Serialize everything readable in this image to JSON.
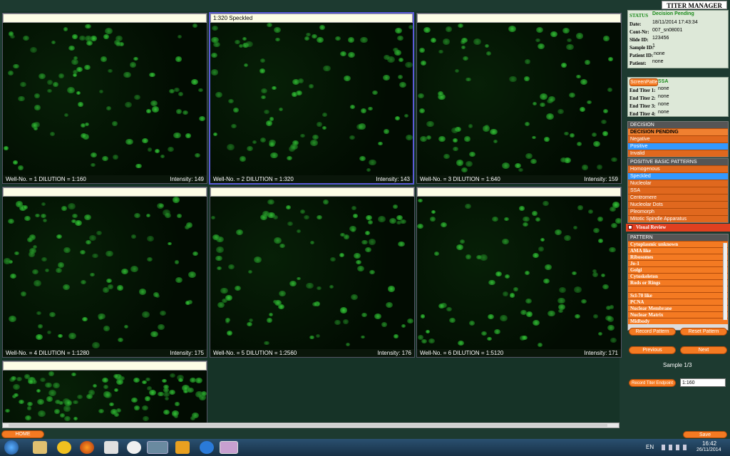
{
  "app": {
    "title": "TITER MANAGER"
  },
  "wells": [
    {
      "header": "",
      "well": "Well-No. = 1  DILUTION = 1:160",
      "intensity": "Intensity: 149"
    },
    {
      "header": "1:320 Speckled",
      "well": "Well-No. = 2  DILUTION = 1:320",
      "intensity": "Intensity: 143"
    },
    {
      "header": "",
      "well": "Well-No. = 3  DILUTION = 1:640",
      "intensity": "Intensity: 159"
    },
    {
      "header": "",
      "well": "Well-No. = 4  DILUTION = 1:1280",
      "intensity": "Intensity: 175"
    },
    {
      "header": "",
      "well": "Well-No. = 5  DILUTION = 1:2560",
      "intensity": "Intensity: 176"
    },
    {
      "header": "",
      "well": "Well-No. = 6  DILUTION = 1:5120",
      "intensity": "Intensity: 171"
    },
    {
      "header": "",
      "well": "",
      "intensity": ""
    }
  ],
  "status": {
    "label": "STATUS",
    "value": "Decision Pending",
    "date_label": "Date:",
    "date": "18/11/2014  17:43:34",
    "cont_label": "Cont-Nr:",
    "cont": "007_sn08001",
    "slide_label": "Slide ID:",
    "slide": "123456",
    "sample_label": "Sample ID:",
    "sample": "1",
    "patient_id_label": "Patient ID:",
    "patient_id": "none",
    "patient_label": "Patient:",
    "patient": "none"
  },
  "screen": {
    "button": "ScreenPattern",
    "value": "SSA",
    "t1_label": "End Titer 1:",
    "t1": "none",
    "t2_label": "End Titer 2:",
    "t2": "none",
    "t3_label": "End Titer 3:",
    "t3": "none",
    "t4_label": "End Titer 4:",
    "t4": "none"
  },
  "decision": {
    "caption": "DECISION",
    "items": [
      "DECISION PENDING",
      "Negative",
      "Positive",
      "Invalid"
    ]
  },
  "basic": {
    "caption": "POSITIVE BASIC PATTERNS",
    "items": [
      "Homogenous",
      "Speckled",
      "Nucleolar",
      "SSA",
      "Centromere",
      "Nucleolar Dots",
      "Pleomorph",
      "Mitotic Spindle Apparatus"
    ]
  },
  "visual_review": "Visual Review",
  "pattern": {
    "caption": "PATTERN",
    "items": [
      "Cytoplasmic unknown",
      "AMA like",
      "Ribosomes",
      "Jo-1",
      "Golgi",
      "Cytoskeleton",
      "Rods or Rings",
      "",
      "Scl-70 like",
      "PCNA",
      "Nuclear Membrane",
      "Nuclear Matrix",
      "Midbody"
    ]
  },
  "buttons": {
    "record_pattern": "Record Pattern",
    "reset_pattern": "Reset Pattern",
    "previous": "Previous",
    "next": "Next",
    "record_titer": "Record Titer Endpoint",
    "home": "HOME",
    "save": "Save"
  },
  "sample_counter": "Sample 1/3",
  "titer_value": "1:160",
  "taskbar": {
    "lang": "EN",
    "time": "16:42",
    "date": "26/11/2014"
  }
}
